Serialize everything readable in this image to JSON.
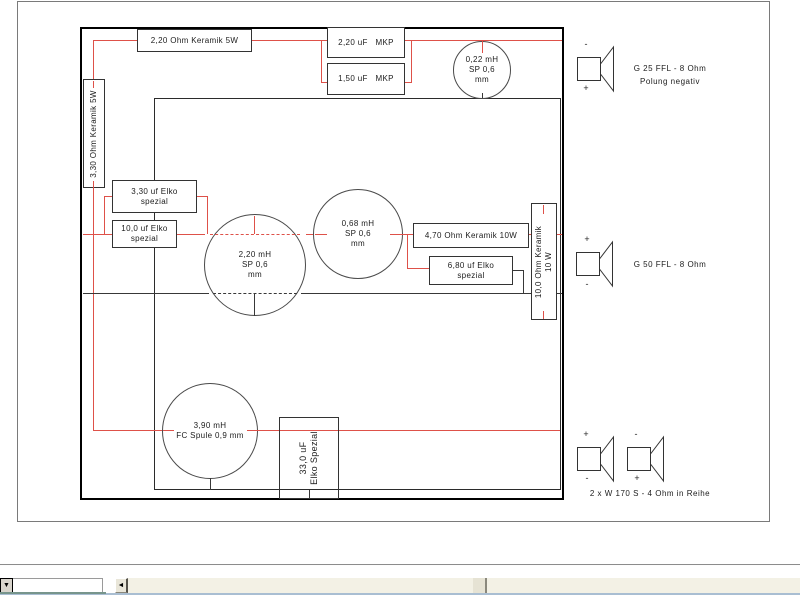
{
  "colors": {
    "wire_red": "#de5149",
    "wire_black": "#383838",
    "frame": "#000000"
  },
  "components": {
    "r330": {
      "label": "3,30 Ohm Keramik 5W"
    },
    "r220": {
      "label": "2,20 Ohm Keramik 5W"
    },
    "c220mkp": {
      "label": "2,20 uF   MKP"
    },
    "c150mkp": {
      "label": "1,50 uF   MKP"
    },
    "l022": {
      "l1": "0,22 mH",
      "l2": "SP 0,6",
      "l3": "mm"
    },
    "c330elko": {
      "l1": "3,30 uf Elko",
      "l2": "spezial"
    },
    "c100elko": {
      "l1": "10,0 uf Elko",
      "l2": "spezial"
    },
    "l220": {
      "l1": "2,20 mH",
      "l2": "SP 0,6",
      "l3": "mm"
    },
    "l068": {
      "l1": "0,68 mH",
      "l2": "SP 0,6",
      "l3": "mm"
    },
    "r470": {
      "label": "4,70 Ohm Keramik 10W"
    },
    "c680elko": {
      "l1": "6,80 uf Elko",
      "l2": "spezial"
    },
    "r100": {
      "l1": "10,0 Ohm Keramik",
      "l2": "10 W"
    },
    "l390": {
      "l1": "3,90 mH",
      "l2": "FC Spule 0,9 mm"
    },
    "c330f": {
      "l1": "33,0 uF",
      "l2": "Elko Spezial"
    }
  },
  "speakers": {
    "tweeter": {
      "top_sign": "-",
      "bottom_sign": "+",
      "label1": "G 25 FFL - 8 Ohm",
      "label2": "Polung negativ"
    },
    "midrange": {
      "top_sign": "+",
      "bottom_sign": "-",
      "label1": "G 50 FFL - 8 Ohm"
    },
    "woofer_left": {
      "top_sign": "+",
      "bottom_sign": "-"
    },
    "woofer_right": {
      "top_sign": "-",
      "bottom_sign": "+"
    },
    "woofer_label": "2 x W 170 S - 4 Ohm in Reihe"
  },
  "statusbar": {
    "dropdown_arrow": "▼",
    "scroll_left_arrow": "◄",
    "field_value": ""
  }
}
